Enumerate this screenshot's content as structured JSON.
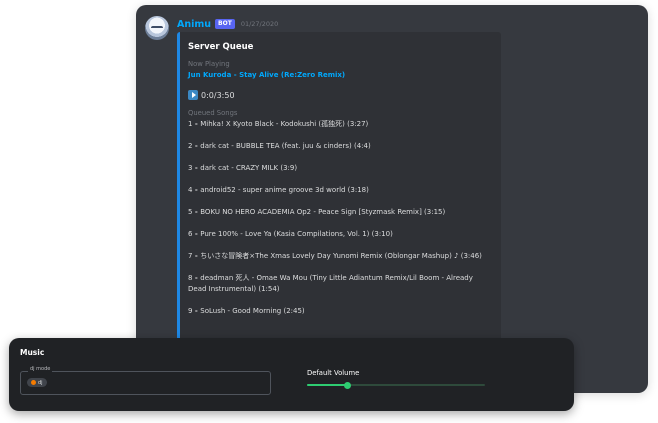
{
  "message": {
    "username": "Animu",
    "bot_tag": "BOT",
    "timestamp": "01/27/2020",
    "avatar_icon": "anime-character-avatar"
  },
  "embed": {
    "accent_color": "#1e88e5",
    "title": "Server Queue",
    "now_playing_label": "Now Playing",
    "now_playing_track": "Jun Kuroda - Stay Alive (Re:Zero Remix)",
    "play_icon": "play-icon",
    "progress_text": "0:0/3:50",
    "queued_label": "Queued Songs",
    "queue": [
      {
        "num": "1",
        "sep": " - ",
        "title": "Mihka! X Kyoto Black - Kodokushi (孤独死) (3:27)"
      },
      {
        "num": "2",
        "sep": " - ",
        "title": "dark cat - BUBBLE TEA (feat. juu & cinders) (4:4)"
      },
      {
        "num": "3",
        "sep": " - ",
        "title": "dark cat - CRAZY MILK (3:9)"
      },
      {
        "num": "4",
        "sep": " - ",
        "title": "android52 - super anime groove 3d world (3:18)"
      },
      {
        "num": "5",
        "sep": " - ",
        "title": "BOKU NO HERO ACADEMIA Op2 - Peace Sign [Styzmask Remix] (3:15)"
      },
      {
        "num": "6",
        "sep": " - ",
        "title": "Pure 100% - Love Ya (Kasia Compilations, Vol. 1) (3:10)"
      },
      {
        "num": "7",
        "sep": " - ",
        "title": "ちいさな冒険者×The Xmas Lovely Day Yunomi Remix (Oblongar Mashup) ♪ (3:46)"
      },
      {
        "num": "8",
        "sep": " - ",
        "title": "deadman 死人 - Omae Wa Mou (Tiny Little Adiantum Remix/Lil Boom - Already Dead Instrumental) (1:54)"
      },
      {
        "num": "9",
        "sep": " - ",
        "title": "SoLush - Good Morning (2:45)"
      }
    ]
  },
  "music_panel": {
    "title": "Music",
    "mode_label": "dj mode",
    "mode_value": "dj",
    "mode_dot_color": "#f57c00",
    "volume_label": "Default Volume",
    "volume_level": 0.23,
    "slider_color": "#2ecc71"
  }
}
